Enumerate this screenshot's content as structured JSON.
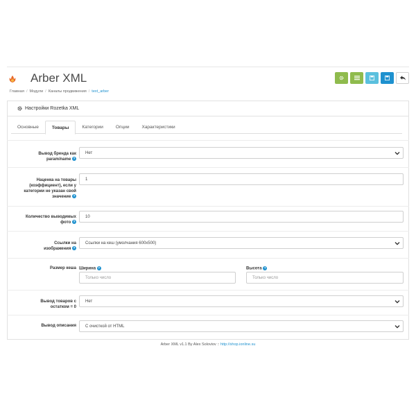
{
  "header": {
    "title": "Arber XML",
    "logo_icon": "flame-logo-icon",
    "buttons": [
      {
        "name": "settings-button",
        "icon": "gear-icon",
        "color": "#8fbb4d"
      },
      {
        "name": "list-button",
        "icon": "list-icon",
        "color": "#8fbb4d"
      },
      {
        "name": "save-light-button",
        "icon": "save-icon",
        "color": "#5bc0de"
      },
      {
        "name": "save-button",
        "icon": "save-icon",
        "color": "#1e91cf"
      },
      {
        "name": "back-button",
        "icon": "reply-icon",
        "color": "#ffffff"
      }
    ]
  },
  "breadcrumb": [
    "Главная",
    "Модули",
    "Каналы продвижения",
    "text_arber"
  ],
  "panel": {
    "title": "Настройки Rozetka XML",
    "icon": "gear-icon"
  },
  "tabs": [
    "Основные",
    "Товары",
    "Категории",
    "Опции",
    "Характеристики"
  ],
  "active_tab": "Товары",
  "fields": {
    "brand": {
      "label_line1": "Вывод бренда как",
      "label_line2": "param/name",
      "value": "Нет"
    },
    "markup": {
      "label_line1": "Наценка на товары",
      "label_line2": "(коэффициент), если у",
      "label_line3": "категории не указан свой",
      "label_line4": "значение",
      "value": "1"
    },
    "photo_count": {
      "label_line1": "Количество выводимых",
      "label_line2": "фото",
      "value": "10"
    },
    "image_links": {
      "label_line1": "Ссылки на",
      "label_line2": "изображения",
      "value": "Ссылки на кеш (умолчания 600x500)"
    },
    "cache_size": {
      "label": "Размер кеша",
      "width_label": "Ширина",
      "height_label": "Высота",
      "width_placeholder": "Только число",
      "height_placeholder": "Только число"
    },
    "zero_stock": {
      "label_line1": "Вывод товаров с",
      "label_line2": "остатком = 0",
      "value": "Нет"
    },
    "description": {
      "label": "Вывод описания",
      "value": "С очисткой от HTML"
    }
  },
  "footer": {
    "text": "Arber XML v1.1 By Alex Soloviov :: ",
    "link": "http://shop.ionline.su"
  },
  "colors": {
    "accent": "#1e91cf",
    "green": "#8fbb4d",
    "cyan": "#5bc0de"
  }
}
